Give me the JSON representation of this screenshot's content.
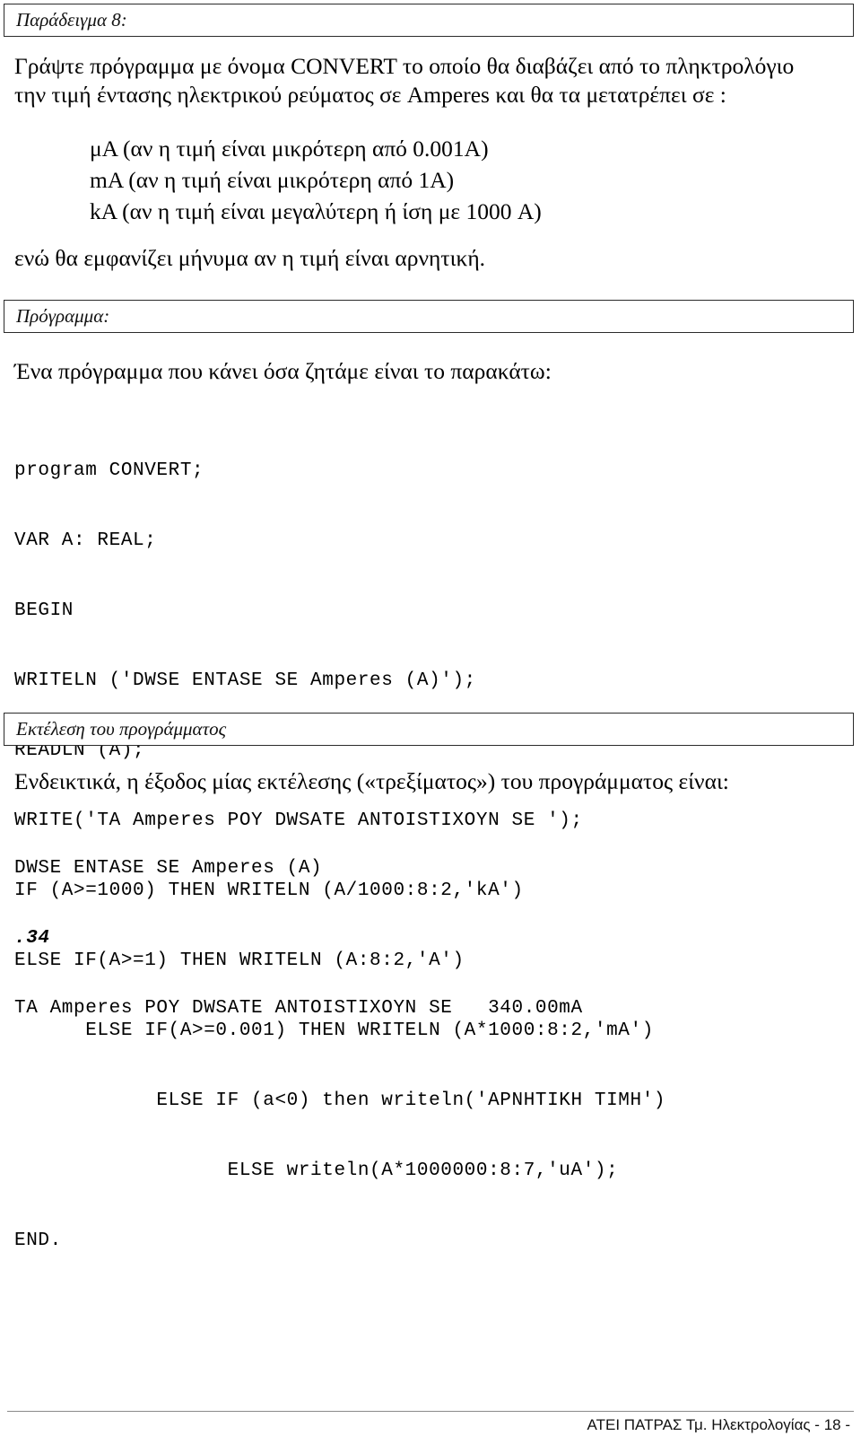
{
  "document": {
    "sections": {
      "example_header": "Παράδειγμα 8:",
      "program_header": "Πρόγραμμα:",
      "execution_header": "Εκτέλεση του προγράμματος"
    },
    "intro": {
      "line1": "Γράψτε πρόγραμμα με όνομα CONVERT το οποίο θα διαβάζει από το πληκτρολόγιο",
      "line2": "την τιμή έντασης ηλεκτρικού ρεύματος σε Amperes και θα τα μετατρέπει σε :"
    },
    "unit_list": {
      "item1": "μA (αν η τιμή είναι μικρότερη από 0.001A)",
      "item2": "mA (αν η τιμή είναι μικρότερη από 1A)",
      "item3": "kA (αν η τιμή είναι μεγαλύτερη ή ίση με 1000 A)"
    },
    "negative_note": "ενώ θα εμφανίζει μήνυμα αν η τιμή είναι αρνητική.",
    "program_note": "Ένα πρόγραμμα που κάνει όσα ζητάμε είναι το παρακάτω:",
    "program_code": {
      "line01": "program CONVERT;",
      "line02": "VAR A: REAL;",
      "line03": "BEGIN",
      "line04": "WRITELN ('DWSE ENTASE SE Amperes (A)');",
      "line05": "READLN (A);",
      "line06": "WRITE('TA Amperes POY DWSATE ANTOISTIXOYN SE ');",
      "line07": "IF (A>=1000) THEN WRITELN (A/1000:8:2,'kA')",
      "line08": "ELSE IF(A>=1) THEN WRITELN (A:8:2,'A')",
      "line09": "      ELSE IF(A>=0.001) THEN WRITELN (A*1000:8:2,'mA')",
      "line10": "            ELSE IF (a<0) then writeln('APNHTIKH TIMH')",
      "line11": "                  ELSE writeln(A*1000000:8:7,'uA');",
      "line12": "END."
    },
    "execution_note": "Ενδεικτικά,  η έξοδος μίας εκτέλεσης («τρεξίματος») του προγράμματος είναι:",
    "execution_output": {
      "prompt": "DWSE ENTASE SE Amperes (A)",
      "input_value": ".34",
      "result": "TA Amperes POY DWSATE ANTOISTIXOYN SE   340.00mA"
    },
    "footer": {
      "text": "ΑΤΕΙ ΠΑΤΡΑΣ Τμ. Ηλεκτρολογίας - 18 -"
    },
    "colors": {
      "text": "#000000",
      "box_border": "#2b2b2b",
      "footer_rule": "#8a8a8a",
      "background": "#ffffff"
    }
  }
}
